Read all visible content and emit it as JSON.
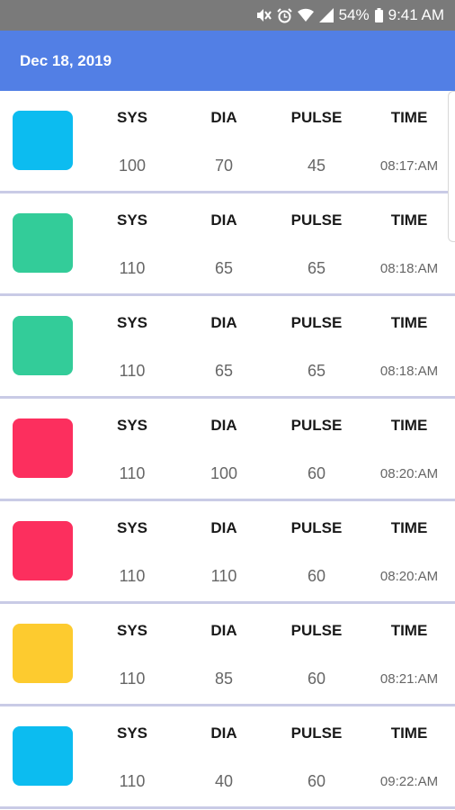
{
  "status_bar": {
    "battery": "54%",
    "time": "9:41 AM",
    "icons": [
      "mute-icon",
      "alarm-icon",
      "wifi-icon",
      "signal-icon",
      "battery-icon"
    ]
  },
  "header": {
    "date": "Dec 18, 2019"
  },
  "colors": {
    "header": "#527fe5",
    "status_bar": "#7a7a7a",
    "blue": "#0cbcf0",
    "green": "#33cc99",
    "red": "#fc2f5e",
    "yellow": "#fdcb2f"
  },
  "labels": {
    "sys": "SYS",
    "dia": "DIA",
    "pulse": "PULSE",
    "time": "TIME"
  },
  "readings": [
    {
      "color": "#0cbcf0",
      "sys": "100",
      "dia": "70",
      "pulse": "45",
      "time": "08:17:AM"
    },
    {
      "color": "#33cc99",
      "sys": "110",
      "dia": "65",
      "pulse": "65",
      "time": "08:18:AM"
    },
    {
      "color": "#33cc99",
      "sys": "110",
      "dia": "65",
      "pulse": "65",
      "time": "08:18:AM"
    },
    {
      "color": "#fc2f5e",
      "sys": "110",
      "dia": "100",
      "pulse": "60",
      "time": "08:20:AM"
    },
    {
      "color": "#fc2f5e",
      "sys": "110",
      "dia": "110",
      "pulse": "60",
      "time": "08:20:AM"
    },
    {
      "color": "#fdcb2f",
      "sys": "110",
      "dia": "85",
      "pulse": "60",
      "time": "08:21:AM"
    },
    {
      "color": "#0cbcf0",
      "sys": "110",
      "dia": "40",
      "pulse": "60",
      "time": "09:22:AM"
    }
  ]
}
